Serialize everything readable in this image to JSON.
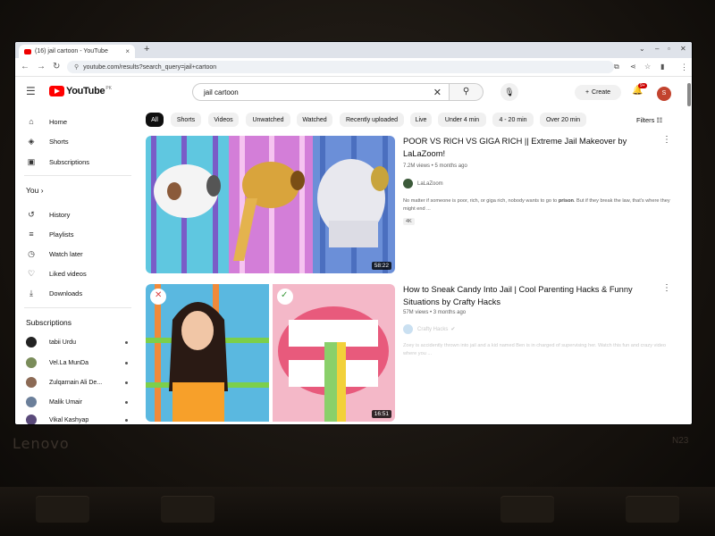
{
  "browser": {
    "tab_title": "(16) jail cartoon - YouTube",
    "tab_close": "×",
    "new_tab": "+",
    "url": "youtube.com/results?search_query=jail+cartoon"
  },
  "youtube": {
    "logo": "YouTube",
    "logo_country": "PK",
    "search_query": "jail cartoon",
    "create_label": "Create",
    "notification_count": "9+",
    "avatar_initial": "S"
  },
  "sidebar": {
    "main": [
      {
        "label": "Home",
        "icon": "home-icon"
      },
      {
        "label": "Shorts",
        "icon": "shorts-icon"
      },
      {
        "label": "Subscriptions",
        "icon": "subscriptions-icon"
      }
    ],
    "you_heading": "You",
    "you_items": [
      {
        "label": "History",
        "icon": "history-icon"
      },
      {
        "label": "Playlists",
        "icon": "playlists-icon"
      },
      {
        "label": "Watch later",
        "icon": "watch-later-icon"
      },
      {
        "label": "Liked videos",
        "icon": "liked-icon"
      },
      {
        "label": "Downloads",
        "icon": "downloads-icon"
      }
    ],
    "subs_heading": "Subscriptions",
    "subscriptions": [
      {
        "name": "tabii Urdu",
        "color": "#222222"
      },
      {
        "name": "Vel.La MunDa",
        "color": "#7a8c5a"
      },
      {
        "name": "Zulqarnain Ali De...",
        "color": "#8c6a55"
      },
      {
        "name": "Malik Umair",
        "color": "#6b7f9a"
      },
      {
        "name": "Vikal Kashyap",
        "color": "#5a4a7a"
      }
    ]
  },
  "chips": [
    "All",
    "Shorts",
    "Videos",
    "Unwatched",
    "Watched",
    "Recently uploaded",
    "Live",
    "Under 4 min",
    "4 - 20 min",
    "Over 20 min"
  ],
  "filters_label": "Filters",
  "results": [
    {
      "title": "POOR VS RICH VS GIGA RICH || Extreme Jail Makeover by LaLaZoom!",
      "meta": "7.2M views • 5 months ago",
      "channel": "LaLaZoom",
      "desc_a": "No matter if someone is poor, rich, or giga rich, nobody wants to go to ",
      "desc_bold": "prison",
      "desc_b": ". But if they break the law, that's where they might end ...",
      "badge": "4K",
      "duration": "58:22"
    },
    {
      "title": "How to Sneak Candy Into Jail | Cool Parenting Hacks & Funny Situations by Crafty Hacks",
      "meta": "57M views • 3 months ago",
      "channel": "Crafty Hacks",
      "desc": "Zoey is accidently thrown into jail and a kid named Ben is in charged of supervising her. Watch this fun and crazy video where you ...",
      "duration": "16:51"
    }
  ]
}
